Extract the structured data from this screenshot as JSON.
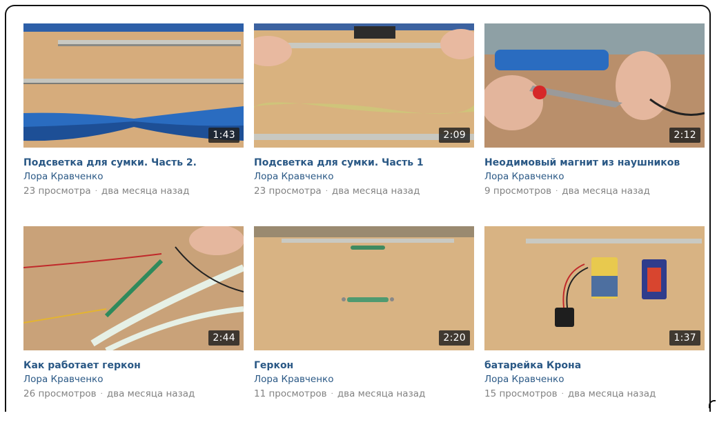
{
  "videos": [
    {
      "title": "Подсветка для сумки. Часть 2.",
      "author": "Лора Кравченко",
      "views": "23 просмотра",
      "age": "два месяца назад",
      "duration": "1:43"
    },
    {
      "title": "Подсветка для сумки. Часть 1",
      "author": "Лора Кравченко",
      "views": "23 просмотра",
      "age": "два месяца назад",
      "duration": "2:09"
    },
    {
      "title": "Неодимовый магнит из наушников",
      "author": "Лора Кравченко",
      "views": "9 просмотров",
      "age": "два месяца назад",
      "duration": "2:12"
    },
    {
      "title": "Как работает геркон",
      "author": "Лора Кравченко",
      "views": "26 просмотров",
      "age": "два месяца назад",
      "duration": "2:44"
    },
    {
      "title": "Геркон",
      "author": "Лора Кравченко",
      "views": "11 просмотров",
      "age": "два месяца назад",
      "duration": "2:20"
    },
    {
      "title": "батарейка Крона",
      "author": "Лора Кравченко",
      "views": "15 просмотров",
      "age": "два месяца назад",
      "duration": "1:37"
    }
  ],
  "separator": "·",
  "colors": {
    "link": "#2a5885",
    "meta": "#828282",
    "duration_bg": "#1e1e1e",
    "table_wood": "#d9b487"
  }
}
